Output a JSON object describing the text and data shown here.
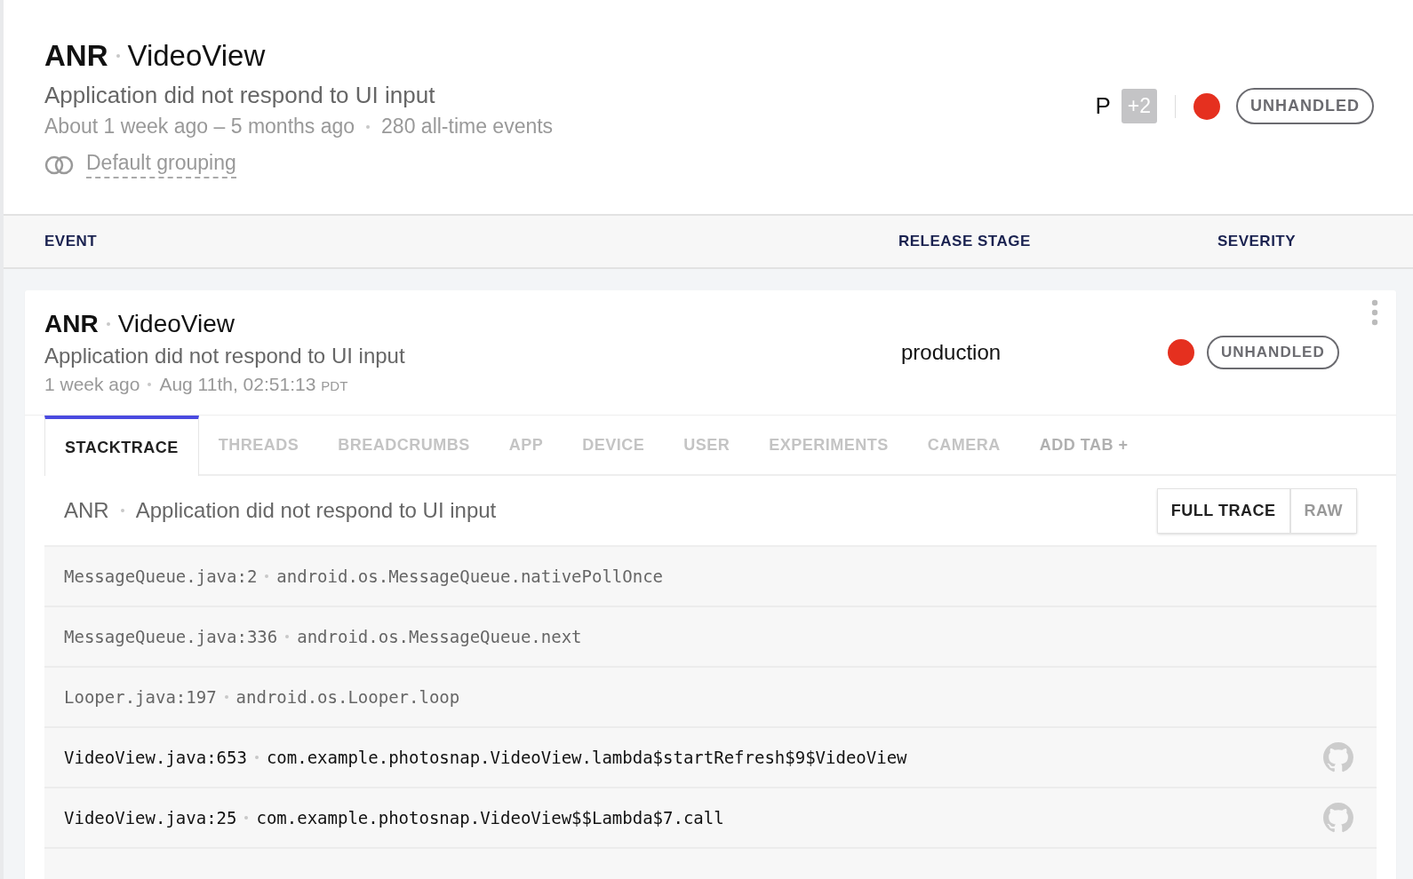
{
  "header": {
    "error_class": "ANR",
    "context": "VideoView",
    "message": "Application did not respond to UI input",
    "time_range": "About 1 week ago – 5 months ago",
    "events": "280 all-time events",
    "grouping": "Default grouping",
    "assignee_initial": "P",
    "assignee_more": "+2",
    "handled_label": "UNHANDLED"
  },
  "columns": [
    {
      "label": "EVENT"
    },
    {
      "label": "RELEASE STAGE"
    },
    {
      "label": "SEVERITY"
    }
  ],
  "event": {
    "error_class": "ANR",
    "context": "VideoView",
    "message": "Application did not respond to UI input",
    "relative_time": "1 week ago",
    "timestamp": "Aug 11th, 02:51:13",
    "timezone": "PDT",
    "release_stage": "production",
    "handled_label": "UNHANDLED"
  },
  "tabs": [
    {
      "label": "STACKTRACE",
      "selected": true
    },
    {
      "label": "THREADS",
      "selected": false
    },
    {
      "label": "BREADCRUMBS",
      "selected": false
    },
    {
      "label": "APP",
      "selected": false
    },
    {
      "label": "DEVICE",
      "selected": false
    },
    {
      "label": "USER",
      "selected": false
    },
    {
      "label": "EXPERIMENTS",
      "selected": false
    },
    {
      "label": "CAMERA",
      "selected": false
    }
  ],
  "add_tab": "ADD TAB +",
  "stacktrace": {
    "error_class": "ANR",
    "message": "Application did not respond to UI input",
    "view_buttons": [
      {
        "label": "FULL TRACE",
        "selected": true
      },
      {
        "label": "RAW",
        "selected": false
      }
    ],
    "frames": [
      {
        "file": "MessageQueue.java:2",
        "method": "android.os.MessageQueue.nativePollOnce",
        "in_project": false
      },
      {
        "file": "MessageQueue.java:336",
        "method": "android.os.MessageQueue.next",
        "in_project": false
      },
      {
        "file": "Looper.java:197",
        "method": "android.os.Looper.loop",
        "in_project": false
      },
      {
        "file": "VideoView.java:653",
        "method": "com.example.photosnap.VideoView.lambda$startRefresh$9$VideoView",
        "in_project": true
      },
      {
        "file": "VideoView.java:25",
        "method": "com.example.photosnap.VideoView$$Lambda$7.call",
        "in_project": true
      }
    ]
  }
}
